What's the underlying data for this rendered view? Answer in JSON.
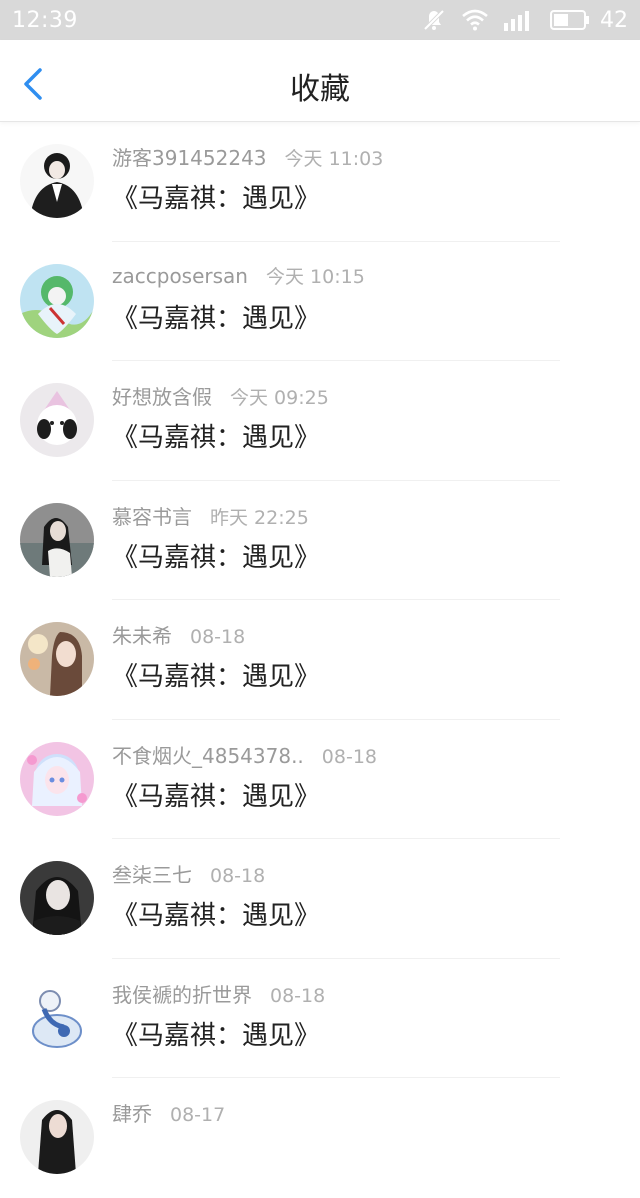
{
  "status_bar": {
    "time": "12:39",
    "battery": "42"
  },
  "header": {
    "title": "收藏"
  },
  "items": [
    {
      "user": "游客391452243",
      "time": "今天 11:03",
      "book": "《马嘉祺：遇见》"
    },
    {
      "user": "zaccposersan",
      "time": "今天 10:15",
      "book": "《马嘉祺：遇见》"
    },
    {
      "user": "好想放含假",
      "time": "今天 09:25",
      "book": "《马嘉祺：遇见》"
    },
    {
      "user": "慕容书言",
      "time": "昨天 22:25",
      "book": "《马嘉祺：遇见》"
    },
    {
      "user": "朱未希",
      "time": "08-18",
      "book": "《马嘉祺：遇见》"
    },
    {
      "user": "不食烟火_4854378..",
      "time": "08-18",
      "book": "《马嘉祺：遇见》"
    },
    {
      "user": "叁柒三七",
      "time": "08-18",
      "book": "《马嘉祺：遇见》"
    },
    {
      "user": "我侯褫的折世界",
      "time": "08-18",
      "book": "《马嘉祺：遇见》"
    },
    {
      "user": "肆乔",
      "time": "08-17",
      "book": ""
    }
  ]
}
